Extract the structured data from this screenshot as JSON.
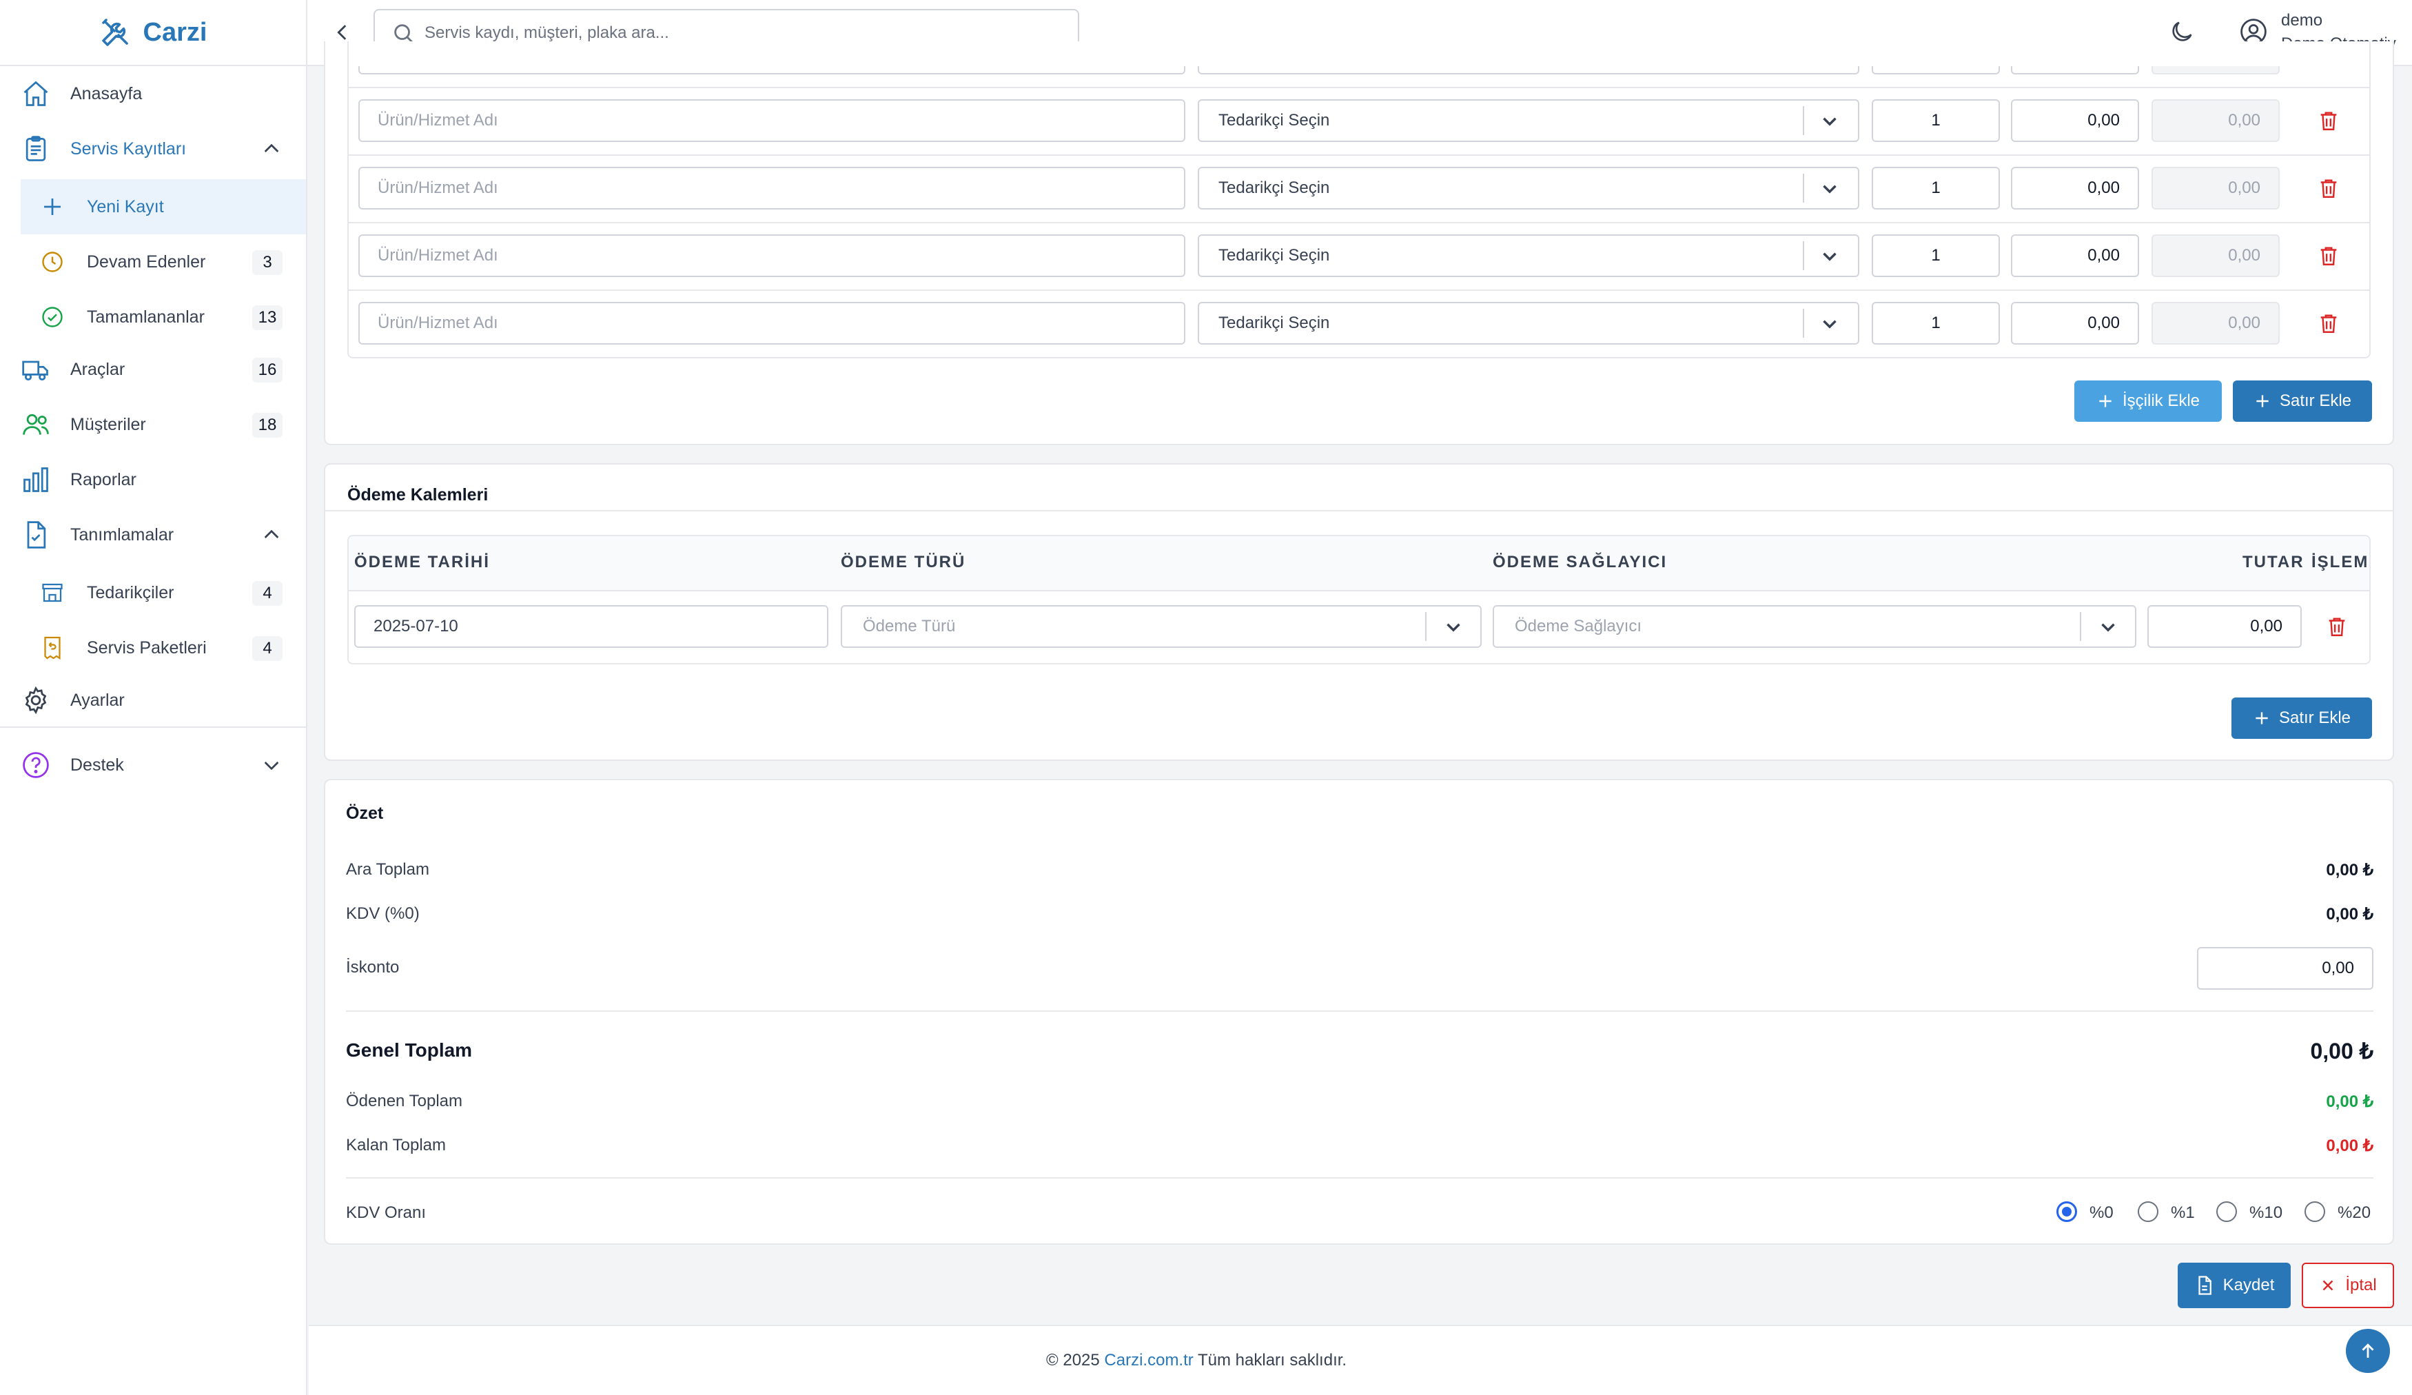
{
  "brand": {
    "name": "Carzi"
  },
  "sidebar": {
    "items": [
      {
        "label": "Anasayfa"
      },
      {
        "label": "Servis Kayıtları"
      },
      {
        "label": "Yeni Kayıt"
      },
      {
        "label": "Devam Edenler",
        "count": "3"
      },
      {
        "label": "Tamamlananlar",
        "count": "13"
      },
      {
        "label": "Araçlar",
        "count": "16"
      },
      {
        "label": "Müşteriler",
        "count": "18"
      },
      {
        "label": "Raporlar"
      },
      {
        "label": "Tanımlamalar"
      },
      {
        "label": "Tedarikçiler",
        "count": "4"
      },
      {
        "label": "Servis Paketleri",
        "count": "4"
      },
      {
        "label": "Ayarlar"
      },
      {
        "label": "Destek"
      }
    ]
  },
  "header": {
    "search_placeholder": "Servis kaydı, müşteri, plaka ara...",
    "user_name": "demo",
    "company": "Demo Otomotiv"
  },
  "items": {
    "rows": [
      {
        "name_placeholder": "Ürün/Hizmet Adı",
        "supplier": "Tedarikçi Seçin",
        "qty": "1",
        "price": "0,00",
        "total": "0,00"
      },
      {
        "name_placeholder": "Ürün/Hizmet Adı",
        "supplier": "Tedarikçi Seçin",
        "qty": "1",
        "price": "0,00",
        "total": "0,00"
      },
      {
        "name_placeholder": "Ürün/Hizmet Adı",
        "supplier": "Tedarikçi Seçin",
        "qty": "1",
        "price": "0,00",
        "total": "0,00"
      },
      {
        "name_placeholder": "Ürün/Hizmet Adı",
        "supplier": "Tedarikçi Seçin",
        "qty": "1",
        "price": "0,00",
        "total": "0,00"
      }
    ],
    "add_labor_label": "İşçilik Ekle",
    "add_row_label": "Satır Ekle"
  },
  "payments": {
    "title": "Ödeme Kalemleri",
    "headers": {
      "date": "ÖDEME TARİHİ",
      "type": "ÖDEME TÜRÜ",
      "provider": "ÖDEME SAĞLAYICI",
      "amount": "TUTAR",
      "action": "İŞLEM"
    },
    "row": {
      "date": "2025-07-10",
      "type_placeholder": "Ödeme Türü",
      "provider_placeholder": "Ödeme Sağlayıcı",
      "amount": "0,00"
    },
    "add_row_label": "Satır Ekle"
  },
  "summary": {
    "title": "Özet",
    "subtotal_label": "Ara Toplam",
    "subtotal": "0,00 ₺",
    "vat_label": "KDV (%0)",
    "vat": "0,00 ₺",
    "discount_label": "İskonto",
    "discount": "0,00",
    "grand_total_label": "Genel Toplam",
    "grand_total": "0,00 ₺",
    "paid_label": "Ödenen Toplam",
    "paid": "0,00 ₺",
    "remaining_label": "Kalan Toplam",
    "remaining": "0,00 ₺",
    "vat_rate_label": "KDV Oranı",
    "vat_options": [
      "%0",
      "%1",
      "%10",
      "%20"
    ],
    "vat_selected": "%0"
  },
  "actions": {
    "save_label": "Kaydet",
    "cancel_label": "İptal"
  },
  "footer": {
    "prefix": "© 2025 ",
    "link": "Carzi.com.tr",
    "suffix": " Tüm hakları saklıdır."
  },
  "colors": {
    "primary": "#2a77b8",
    "light_primary": "#4aa3e0",
    "danger": "#dc2626",
    "success": "#16a34a"
  }
}
